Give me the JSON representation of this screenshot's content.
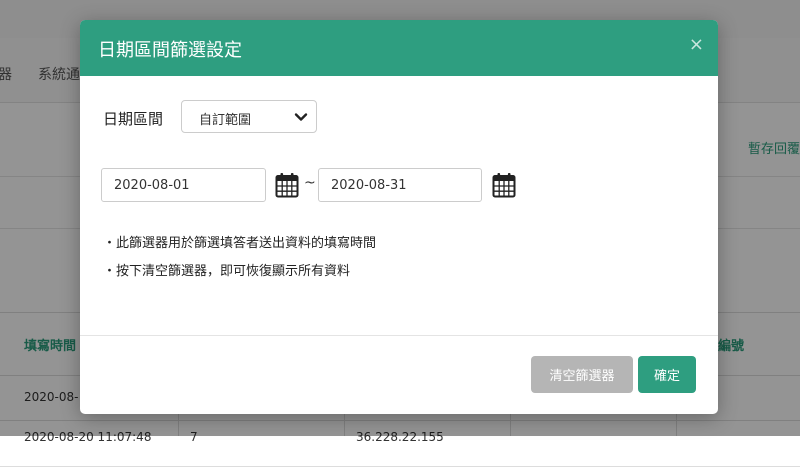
{
  "background": {
    "tabs": [
      "器",
      "系統通"
    ],
    "save_link": "暫存回覆",
    "table": {
      "headers": [
        "填寫時間",
        "編號"
      ],
      "rows": [
        [
          "2020-08-",
          "",
          ""
        ],
        [
          "2020-08-20 11:07:48",
          "7",
          "36.228.22.155"
        ]
      ]
    }
  },
  "modal": {
    "title": "日期區間篩選設定",
    "close": "×",
    "range_label": "日期區間",
    "range_select": {
      "value": "自訂範圍"
    },
    "date_from": "2020-08-01",
    "date_to": "2020-08-31",
    "separator": "~",
    "notes": [
      "・此篩選器用於篩選填答者送出資料的填寫時間",
      "・按下清空篩選器，即可恢復顯示所有資料"
    ],
    "buttons": {
      "clear": "清空篩選器",
      "confirm": "確定"
    }
  },
  "colors": {
    "accent": "#2e9e80",
    "disabled_button": "#b5b5b5"
  },
  "icons": [
    "close-icon",
    "chevron-down-icon",
    "calendar-icon"
  ]
}
